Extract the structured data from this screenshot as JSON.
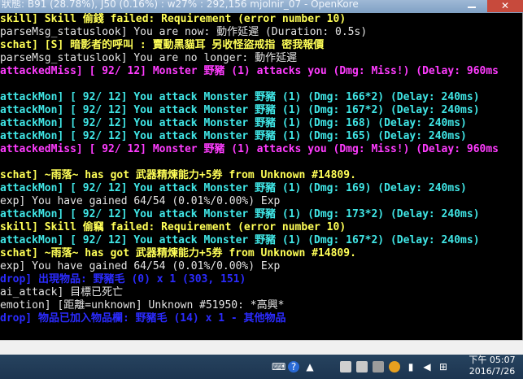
{
  "window": {
    "title": "狀態: B91 (28.78%), J50 (0.16%) : w27% : 292,156 mjolnir_07 - OpenKore",
    "close_label": "✕"
  },
  "console": {
    "lines": [
      {
        "text": "skill] Skill 偷錢 failed: Requirement (error number 10)",
        "color": "yellow"
      },
      {
        "text": "parseMsg_statuslook] You are now: 動作延遲 (Duration: 0.5s)",
        "color": "gray"
      },
      {
        "text": "schat] [S] 暗影者的呼叫 : 賣動黑貓耳 另收怪盜戒指 密我報價",
        "color": "yellow"
      },
      {
        "text": "parseMsg_statuslook] You are no longer: 動作延遲",
        "color": "gray"
      },
      {
        "text": "attackedMiss] [ 92/ 12] Monster 野豬 (1) attacks you (Dmg: Miss!) (Delay: 960ms",
        "color": "magenta"
      },
      {
        "text": "",
        "color": "gray"
      },
      {
        "text": "attackMon] [ 92/ 12] You attack Monster 野豬 (1) (Dmg: 166*2) (Delay: 240ms)",
        "color": "cyan"
      },
      {
        "text": "attackMon] [ 92/ 12] You attack Monster 野豬 (1) (Dmg: 167*2) (Delay: 240ms)",
        "color": "cyan"
      },
      {
        "text": "attackMon] [ 92/ 12] You attack Monster 野豬 (1) (Dmg: 168) (Delay: 240ms)",
        "color": "cyan"
      },
      {
        "text": "attackMon] [ 92/ 12] You attack Monster 野豬 (1) (Dmg: 165) (Delay: 240ms)",
        "color": "cyan"
      },
      {
        "text": "attackedMiss] [ 92/ 12] Monster 野豬 (1) attacks you (Dmg: Miss!) (Delay: 960ms",
        "color": "magenta"
      },
      {
        "text": "",
        "color": "gray"
      },
      {
        "text": "schat] ~雨落~ has got 武器精煉能力+5券 from Unknown #14809.",
        "color": "yellow"
      },
      {
        "text": "attackMon] [ 92/ 12] You attack Monster 野豬 (1) (Dmg: 169) (Delay: 240ms)",
        "color": "cyan"
      },
      {
        "text": "exp] You have gained 64/54 (0.01%/0.00%) Exp",
        "color": "gray"
      },
      {
        "text": "attackMon] [ 92/ 12] You attack Monster 野豬 (1) (Dmg: 173*2) (Delay: 240ms)",
        "color": "cyan"
      },
      {
        "text": "skill] Skill 偷竊 failed: Requirement (error number 10)",
        "color": "yellow"
      },
      {
        "text": "attackMon] [ 92/ 12] You attack Monster 野豬 (1) (Dmg: 167*2) (Delay: 240ms)",
        "color": "cyan"
      },
      {
        "text": "schat] ~雨落~ has got 武器精煉能力+5券 from Unknown #14809.",
        "color": "yellow"
      },
      {
        "text": "exp] You have gained 64/54 (0.01%/0.00%) Exp",
        "color": "gray"
      },
      {
        "text": "drop] 出現物品: 野豬毛 (0) x 1 (303, 151)",
        "color": "blue"
      },
      {
        "text": "ai_attack] 目標已死亡",
        "color": "gray"
      },
      {
        "text": "emotion] [距離=unknown] Unknown #51950: *高興*",
        "color": "gray"
      },
      {
        "text": "drop] 物品已加入物品欄: 野豬毛 (14) x 1 - 其他物品",
        "color": "blue"
      }
    ]
  },
  "taskbar": {
    "tray_icons": [
      "keyboard-icon",
      "help-icon",
      "chevron-up-icon",
      "app-icon",
      "network-icon",
      "volume-icon",
      "flag-icon",
      "windows-icon"
    ],
    "time": "下午 05:07",
    "date": "2016/7/26"
  }
}
